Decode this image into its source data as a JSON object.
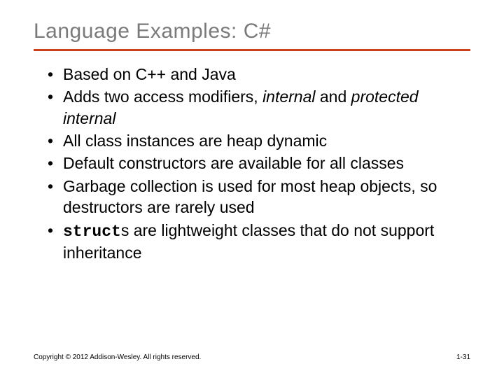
{
  "title": "Language Examples: C#",
  "bullets": [
    {
      "pre": "Based on C++ and Java"
    },
    {
      "pre": "Adds two access modifiers, ",
      "em1": "internal",
      "mid": " and ",
      "em2": "protected internal"
    },
    {
      "pre": "All class instances are heap dynamic"
    },
    {
      "pre": "Default constructors are available for all classes"
    },
    {
      "pre": "Garbage collection is used for most heap objects, so destructors are rarely used"
    },
    {
      "mono": "struct",
      "post": "s are lightweight classes that do not support inheritance"
    }
  ],
  "footer": {
    "copyright": "Copyright © 2012 Addison-Wesley. All rights reserved.",
    "page": "1-31"
  }
}
